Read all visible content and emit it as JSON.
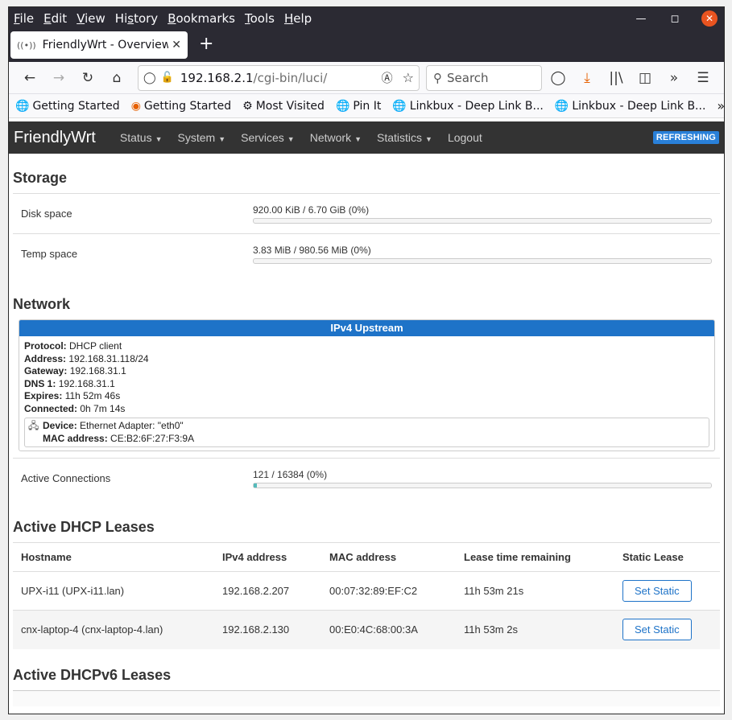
{
  "menubar": {
    "items": [
      {
        "pre": "",
        "key": "F",
        "post": "ile"
      },
      {
        "pre": "",
        "key": "E",
        "post": "dit"
      },
      {
        "pre": "",
        "key": "V",
        "post": "iew"
      },
      {
        "pre": "Hi",
        "key": "s",
        "post": "tory"
      },
      {
        "pre": "",
        "key": "B",
        "post": "ookmarks"
      },
      {
        "pre": "",
        "key": "T",
        "post": "ools"
      },
      {
        "pre": "",
        "key": "H",
        "post": "elp"
      }
    ]
  },
  "tab": {
    "title": "FriendlyWrt - Overview - L"
  },
  "urlbar": {
    "host": "192.168.2.1",
    "path": "/cgi-bin/luci/"
  },
  "searchbar": {
    "placeholder": "Search"
  },
  "bookmarks": [
    {
      "label": "Getting Started",
      "icon": "globe-icon"
    },
    {
      "label": "Getting Started",
      "icon": "firefox-icon"
    },
    {
      "label": "Most Visited",
      "icon": "gear-icon"
    },
    {
      "label": "Pin It",
      "icon": "globe-icon"
    },
    {
      "label": "Linkbux - Deep Link B...",
      "icon": "globe-icon"
    },
    {
      "label": "Linkbux - Deep Link B...",
      "icon": "globe-icon"
    }
  ],
  "app": {
    "brand": "FriendlyWrt",
    "nav": [
      "Status",
      "System",
      "Services",
      "Network",
      "Statistics"
    ],
    "logout": "Logout",
    "badge": "REFRESHING"
  },
  "storage": {
    "title": "Storage",
    "rows": [
      {
        "label": "Disk space",
        "value": "920.00 KiB / 6.70 GiB (0%)",
        "percent": 0
      },
      {
        "label": "Temp space",
        "value": "3.83 MiB / 980.56 MiB (0%)",
        "percent": 0
      }
    ]
  },
  "network": {
    "title": "Network",
    "upstream": {
      "heading": "IPv4 Upstream",
      "fields": [
        {
          "k": "Protocol:",
          "v": "DHCP client"
        },
        {
          "k": "Address:",
          "v": "192.168.31.118/24"
        },
        {
          "k": "Gateway:",
          "v": "192.168.31.1"
        },
        {
          "k": "DNS 1:",
          "v": "192.168.31.1"
        },
        {
          "k": "Expires:",
          "v": "11h 52m 46s"
        },
        {
          "k": "Connected:",
          "v": "0h 7m 14s"
        }
      ],
      "device": {
        "k": "Device:",
        "v": "Ethernet Adapter: \"eth0\""
      },
      "mac": {
        "k": "MAC address:",
        "v": "CE:B2:6F:27:F3:9A"
      }
    },
    "connections": {
      "label": "Active Connections",
      "value": "121 / 16384 (0%)",
      "percent": 0.7
    }
  },
  "dhcp": {
    "title": "Active DHCP Leases",
    "headers": [
      "Hostname",
      "IPv4 address",
      "MAC address",
      "Lease time remaining",
      "Static Lease"
    ],
    "rows": [
      {
        "host": "UPX-i11 (UPX-i11.lan)",
        "ip": "192.168.2.207",
        "mac": "00:07:32:89:EF:C2",
        "lease": "11h 53m 21s",
        "button": "Set Static"
      },
      {
        "host": "cnx-laptop-4 (cnx-laptop-4.lan)",
        "ip": "192.168.2.130",
        "mac": "00:E0:4C:68:00:3A",
        "lease": "11h 53m 2s",
        "button": "Set Static"
      }
    ]
  },
  "dhcp6": {
    "title": "Active DHCPv6 Leases"
  }
}
